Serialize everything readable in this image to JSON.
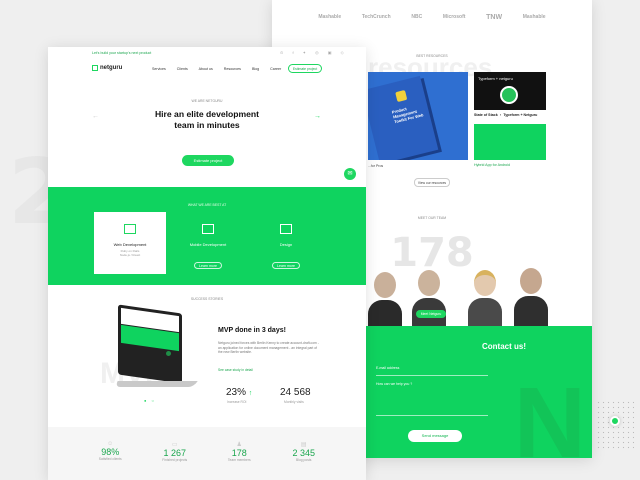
{
  "brand": {
    "name": "netguru",
    "green": "#0fd35f"
  },
  "topbar": {
    "text": "Let's build your startup's next product"
  },
  "nav": {
    "items": [
      "Services",
      "Clients",
      "About us",
      "Resources",
      "Blog",
      "Career"
    ],
    "cta": "Estimate project"
  },
  "hero": {
    "eyebrow": "WE ARE NETGURU",
    "title": "Hire an elite development team in minutes",
    "cta": "Estimate project"
  },
  "services": {
    "eyebrow": "WHAT WE ARE BEST AT",
    "items": [
      {
        "label": "Web Development",
        "sub1": "Ruby on Rails",
        "sub2": "Node.js / React",
        "icon": "web-dev-icon"
      },
      {
        "label": "Mobile Development",
        "icon": "mobile-dev-icon"
      },
      {
        "label": "Design",
        "icon": "design-icon"
      }
    ],
    "more": "Learn more"
  },
  "success": {
    "eyebrow": "SUCCESS STORIES",
    "title": "MVP done in 3 days!",
    "desc": "Netguru joined forces with Berlin Kenny to create account-draft.com - an application for online document management - an integral part of the new Berlin website.",
    "link": "See case study in detail",
    "stat1": {
      "value": "23%",
      "label": "Increase ROI"
    },
    "stat2": {
      "value": "24 568",
      "label": "Monthly visits"
    }
  },
  "stats": [
    {
      "value": "98%",
      "label": "Satisfied clients",
      "icon": "satisfied-icon"
    },
    {
      "value": "1 267",
      "label": "Finished projects",
      "icon": "projects-icon"
    },
    {
      "value": "178",
      "label": "Team members",
      "icon": "team-icon"
    },
    {
      "value": "2 345",
      "label": "Blog posts",
      "icon": "blog-icon"
    }
  ],
  "press": [
    "Mashable",
    "TechCrunch",
    "NBC",
    "Microsoft",
    "TNW",
    "Mashable"
  ],
  "resources": {
    "eyebrow": "BEST RESOURCES",
    "big": "resources",
    "book_title": "Product Management Toolkit For Web",
    "item2_title": "State of Stack ・ Typeform + Netguru",
    "item3_title": "Hybrid App for Android",
    "item1_caption": "...for Pros",
    "button": "View our resources"
  },
  "team": {
    "eyebrow": "MEET OUR TEAM",
    "number": "178",
    "button": "Meet Netguru"
  },
  "contact": {
    "title": "Contact us!",
    "email_placeholder": "E-mail address",
    "help_placeholder": "How can we help you ?",
    "button": "Send message"
  }
}
